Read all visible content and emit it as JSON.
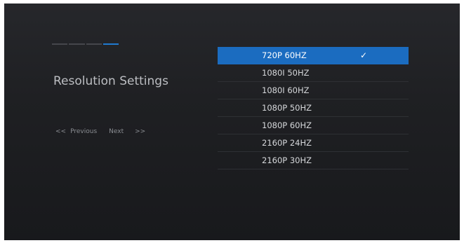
{
  "header": {
    "progress_steps": 4,
    "active_step": 4
  },
  "page": {
    "title": "Resolution Settings"
  },
  "nav": {
    "prev_arrow": "<<",
    "prev_label": "Previous",
    "next_label": "Next",
    "next_arrow": ">>"
  },
  "resolutions": {
    "items": [
      {
        "label": "720P 60HZ",
        "selected": true
      },
      {
        "label": "1080I 50HZ",
        "selected": false
      },
      {
        "label": "1080I 60HZ",
        "selected": false
      },
      {
        "label": "1080P 50HZ",
        "selected": false
      },
      {
        "label": "1080P 60HZ",
        "selected": false
      },
      {
        "label": "2160P 24HZ",
        "selected": false
      },
      {
        "label": "2160P 30HZ",
        "selected": false
      }
    ]
  },
  "colors": {
    "accent": "#1b6cc0",
    "background": "#1f2023"
  },
  "icons": {
    "selected_marker": "checkmark-icon"
  }
}
